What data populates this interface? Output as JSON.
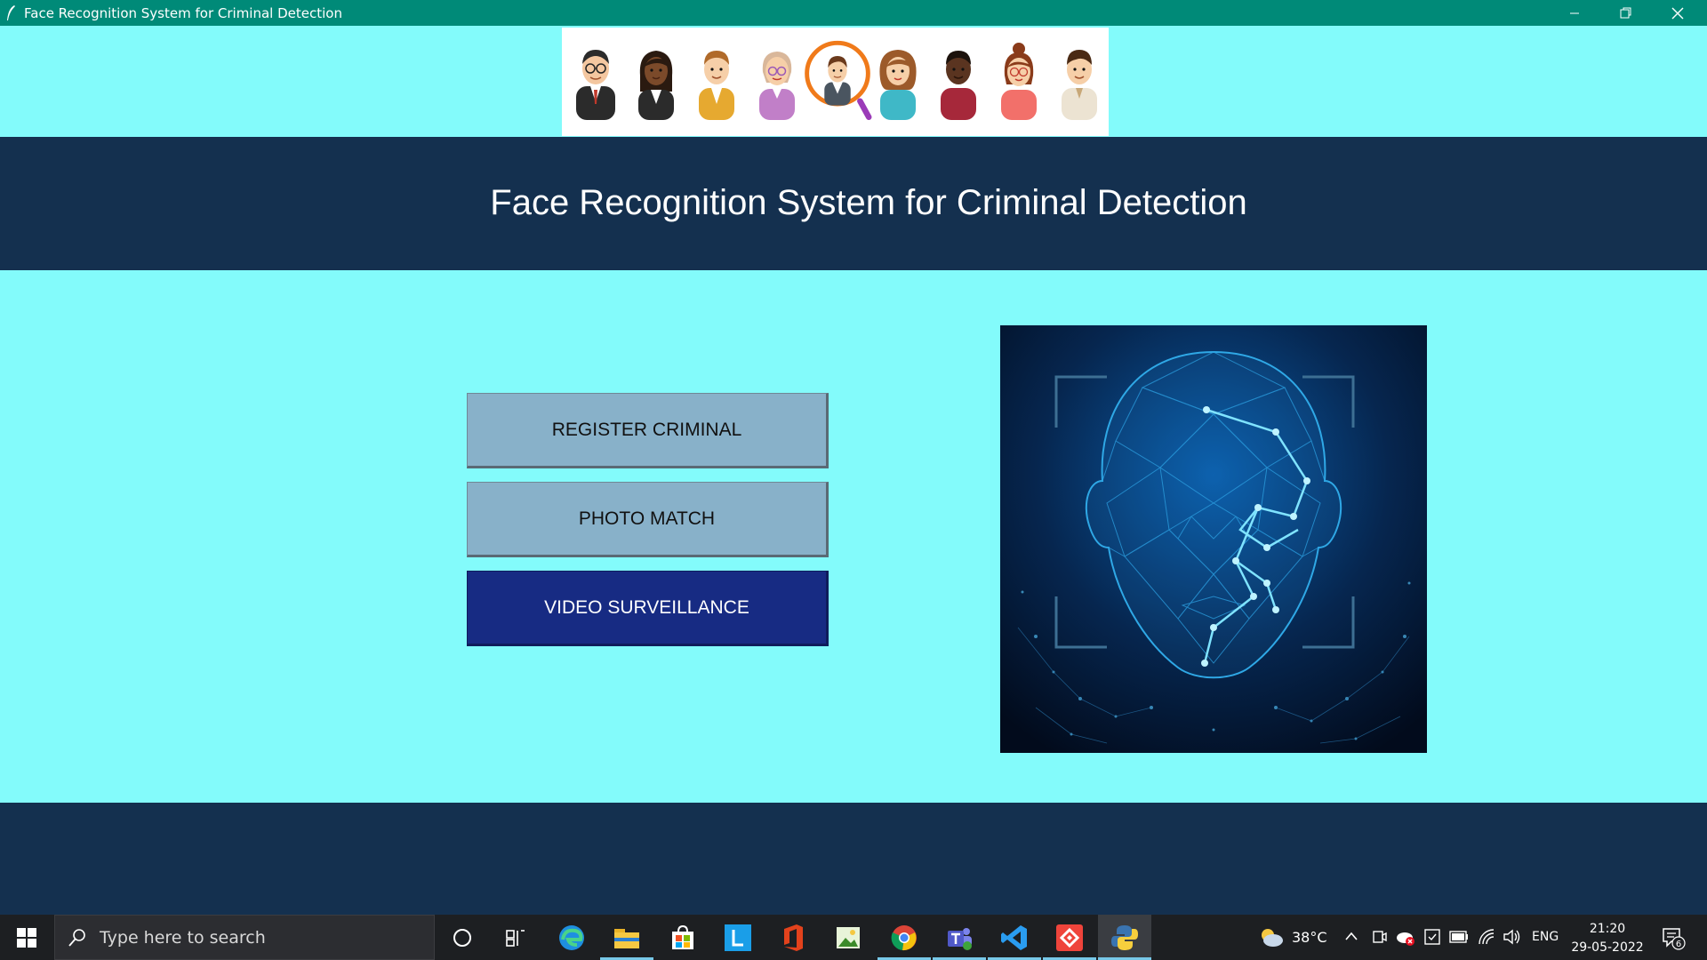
{
  "window": {
    "title": "Face Recognition System for Criminal Detection"
  },
  "header": {
    "title": "Face Recognition System for Criminal Detection"
  },
  "buttons": {
    "register": "REGISTER CRIMINAL",
    "photo_match": "PHOTO MATCH",
    "video": "VIDEO SURVEILLANCE"
  },
  "colors": {
    "background": "#83fbfb",
    "title_bar": "#008a78",
    "header_band": "#14304f",
    "button_light": "#88b1c9",
    "button_dark": "#172b83"
  },
  "taskbar": {
    "search_placeholder": "Type here to search",
    "weather": "38°C",
    "language": "ENG",
    "time": "21:20",
    "date": "29-05-2022",
    "notification_count": "6",
    "apps": [
      "cortana-icon",
      "task-view-icon",
      "edge-icon",
      "file-explorer-icon",
      "store-icon",
      "launcher-l-icon",
      "office-icon",
      "image-viewer-icon",
      "chrome-icon",
      "teams-icon",
      "vscode-icon",
      "anydesk-icon",
      "python-icon"
    ]
  }
}
